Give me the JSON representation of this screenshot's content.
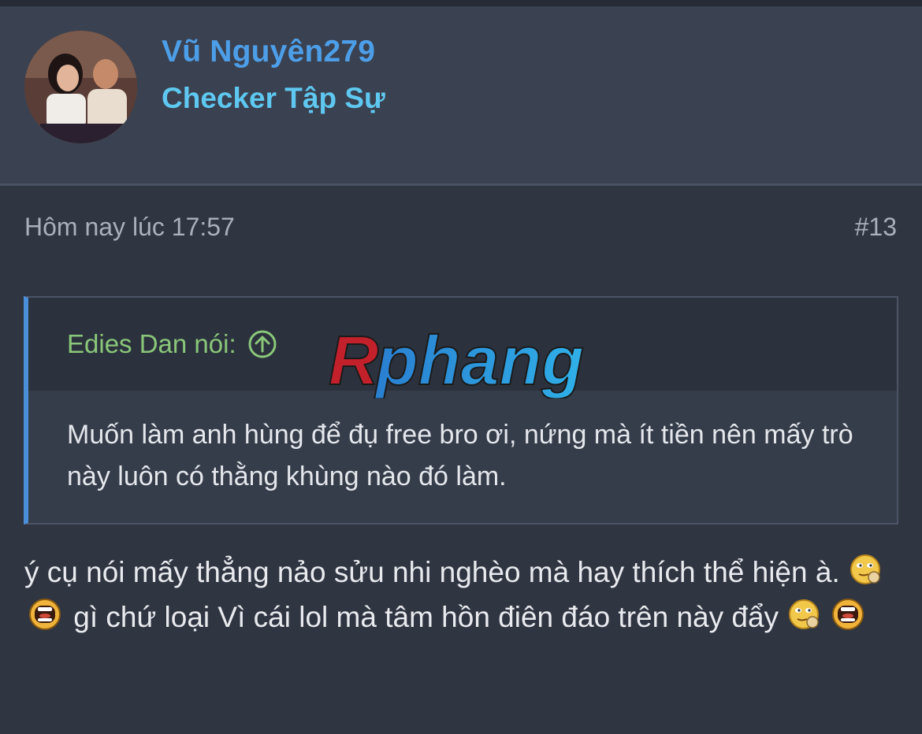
{
  "user": {
    "name": "Vũ Nguyên279",
    "title": "Checker Tập Sự"
  },
  "post": {
    "timestamp": "Hôm nay lúc 17:57",
    "number": "#13",
    "body_part1": "ý cụ nói mấy thẳng nảo sửu nhi nghèo mà hay thích thể hiện à.",
    "body_part2": "gì chứ loại Vì cái lol mà tâm hồn điên đáo trên này đẩy"
  },
  "quote": {
    "author": "Edies Dan nói:",
    "text": "Muốn làm anh hùng để đụ free bro ơi, nứng mà ít tiền nên mấy trò này luôn có thằng khùng nào đó làm."
  },
  "watermark": {
    "text": "Rphang"
  },
  "icons": {
    "avatar": "user-avatar",
    "quote_jump": "arrow-up-circle-icon",
    "emoji_smirk": "smirk-emoji-icon",
    "emoji_shout": "shout-emoji-icon"
  },
  "colors": {
    "username": "#4d9ee8",
    "usertitle": "#5ec8f0",
    "quote_author": "#8ac77a",
    "quote_border": "#4a8fd8",
    "background": "#2f3541"
  }
}
